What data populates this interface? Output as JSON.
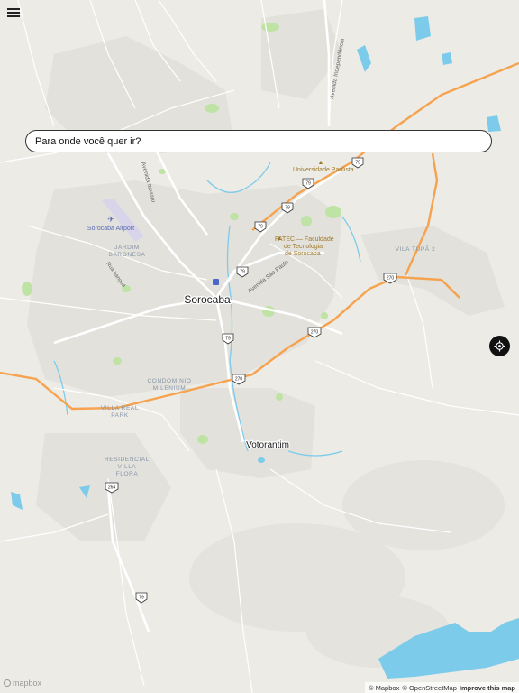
{
  "search": {
    "placeholder": "Para onde você quer ir?"
  },
  "icons": {
    "menu": "menu-icon",
    "locate": "locate-icon",
    "airport": "airport-icon",
    "university": "university-icon"
  },
  "colors": {
    "background": "#ecebe6",
    "highway": "#f6a24e",
    "road": "#ffffff",
    "water": "#7ccbea",
    "park": "#bfe3a5",
    "urban": "#e3e2dc"
  },
  "map": {
    "city_labels": {
      "sorocaba": "Sorocaba",
      "votorantim": "Votorantim"
    },
    "district_labels": {
      "jardim_baronesa": [
        "JARDIM",
        "BARONESA"
      ],
      "condominio_milenium": [
        "CONDOMINIO",
        "MILENIUM"
      ],
      "villa_real_park": [
        "VILLA REAL",
        "PARK"
      ],
      "residencial_villa_flora": [
        "RESIDENCIAL",
        "VILLA",
        "FLORA"
      ],
      "vila_tupa": "VILA TUPÃ 2"
    },
    "poi_labels": {
      "airport": "Sorocaba Airport",
      "universidade_paulista": "Universidade Paulista",
      "fatec": [
        "FATEC — Faculdade",
        "de Tecnologia",
        "de Sorocaba"
      ]
    },
    "street_labels": {
      "avenida_independencia": "Avenida Independência",
      "avenida_itavuvu": "Avenida Itavuvu",
      "avenida_sao_paulo": "Avenida São Paulo",
      "rua_itanguá": "Rua Itanguá"
    },
    "route_shields": [
      "79",
      "79",
      "79",
      "79",
      "79",
      "79",
      "270",
      "270",
      "270",
      "264",
      "79"
    ]
  },
  "footer": {
    "logo": "mapbox",
    "attribution_mapbox": "© Mapbox",
    "attribution_osm": "© OpenStreetMap",
    "improve": "Improve this map"
  }
}
